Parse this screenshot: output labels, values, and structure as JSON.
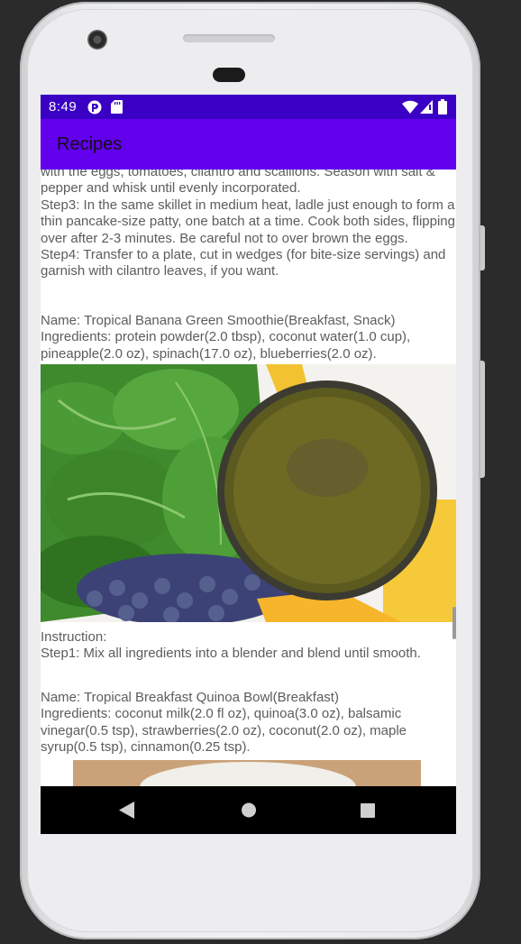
{
  "status_bar": {
    "time": "8:49",
    "icons": [
      "play-protect-icon",
      "sd-card-icon",
      "wifi-icon",
      "signal-icon",
      "battery-icon"
    ]
  },
  "app_bar": {
    "title": "Recipes"
  },
  "recipe_prev": {
    "lines": [
      "with the eggs, tomatoes, cilantro and scallions. Season with salt & pepper and whisk until evenly incorporated.",
      "Step3: In the same skillet in medium heat, ladle just enough to form a thin pancake-size patty, one batch at a time. Cook both sides, flipping over after 2-3 minutes. Be careful not to over brown the eggs.",
      "Step4: Transfer to a plate, cut in wedges (for bite-size servings) and garnish with cilantro leaves, if you want."
    ]
  },
  "recipe_smoothie": {
    "name": "Name: Tropical Banana Green Smoothie(Breakfast, Snack)",
    "ingredients": "Ingredients: protein powder(2.0 tbsp), coconut water(1.0 cup), pineapple(2.0 oz), spinach(17.0 oz), blueberries(2.0 oz).",
    "instruction_label": "Instruction:",
    "step1": "Step1: Mix all ingredients into a blender and blend until smooth."
  },
  "recipe_quinoa": {
    "name": "Name: Tropical Breakfast Quinoa Bowl(Breakfast)",
    "ingredients": "Ingredients: coconut milk(2.0 fl oz), quinoa(3.0 oz), balsamic vinegar(0.5 tsp), strawberries(2.0 oz), coconut(2.0 oz), maple syrup(0.5 tsp), cinnamon(0.25 tsp)."
  },
  "colors": {
    "status_bar": "#3a00c4",
    "app_bar": "#6200ee",
    "nav_bar": "#000000",
    "text": "#5c5c5c"
  }
}
